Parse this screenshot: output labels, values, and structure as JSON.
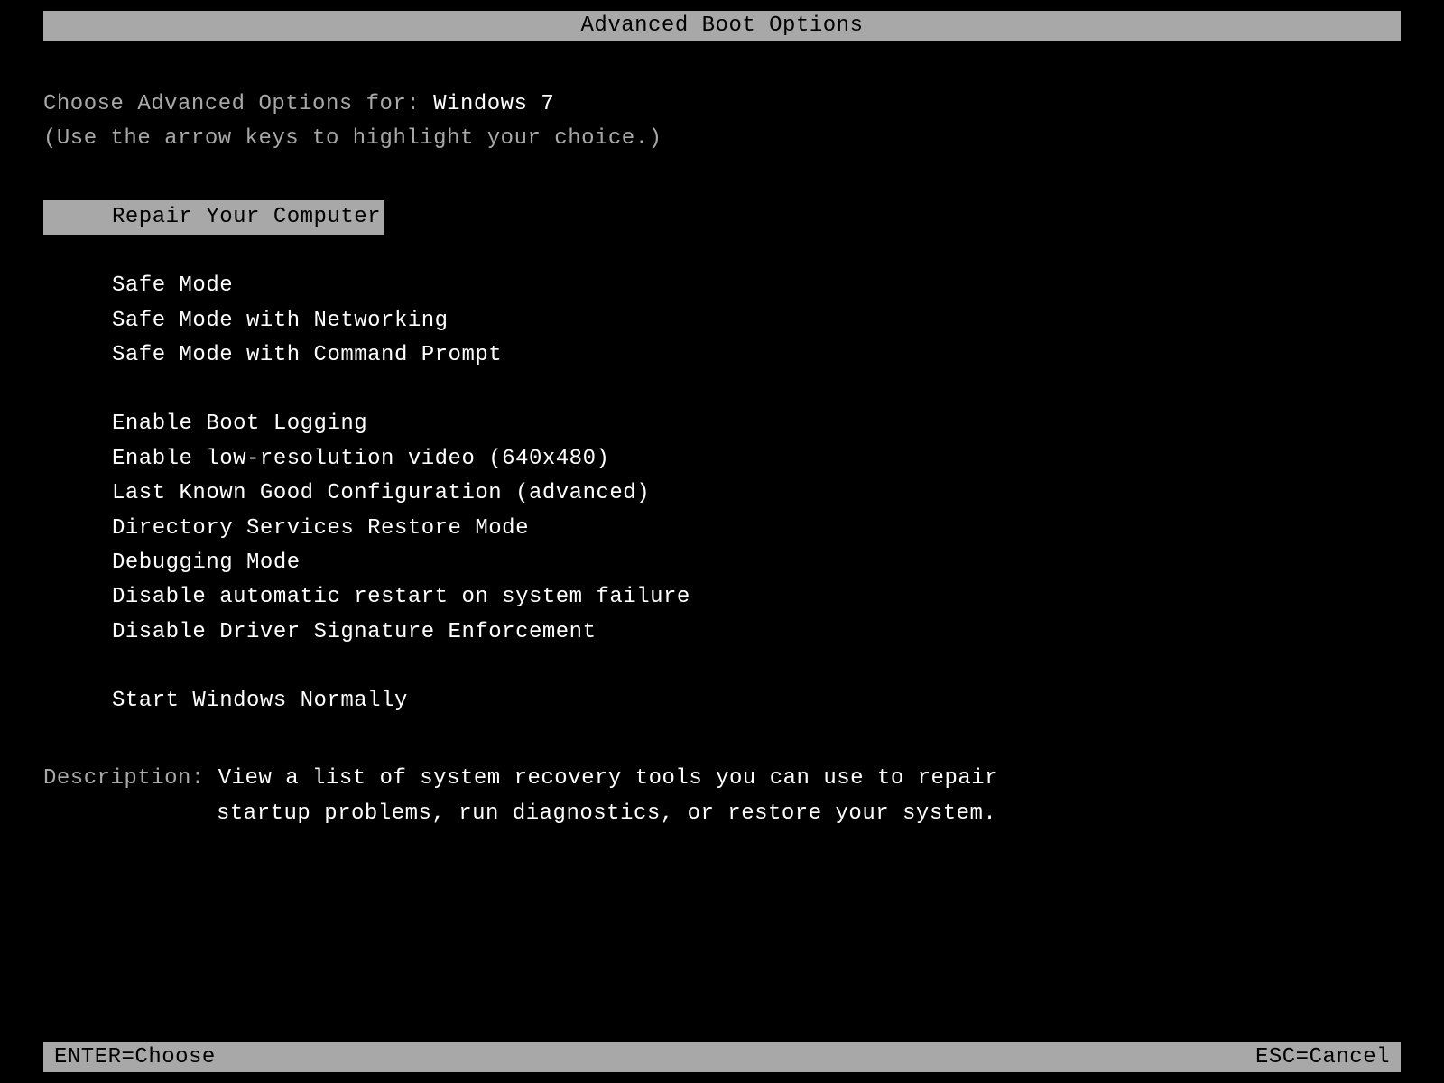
{
  "title": "Advanced Boot Options",
  "prompt": {
    "prefix": "Choose Advanced Options for: ",
    "os": "Windows 7",
    "hint": "(Use the arrow keys to highlight your choice.)"
  },
  "menu": {
    "group1": [
      "Repair Your Computer"
    ],
    "group2": [
      "Safe Mode",
      "Safe Mode with Networking",
      "Safe Mode with Command Prompt"
    ],
    "group3": [
      "Enable Boot Logging",
      "Enable low-resolution video (640x480)",
      "Last Known Good Configuration (advanced)",
      "Directory Services Restore Mode",
      "Debugging Mode",
      "Disable automatic restart on system failure",
      "Disable Driver Signature Enforcement"
    ],
    "group4": [
      "Start Windows Normally"
    ]
  },
  "description": {
    "label": "Description: ",
    "line1": "View a list of system recovery tools you can use to repair",
    "line2": "startup problems, run diagnostics, or restore your system."
  },
  "footer": {
    "left": "ENTER=Choose",
    "right": "ESC=Cancel"
  }
}
